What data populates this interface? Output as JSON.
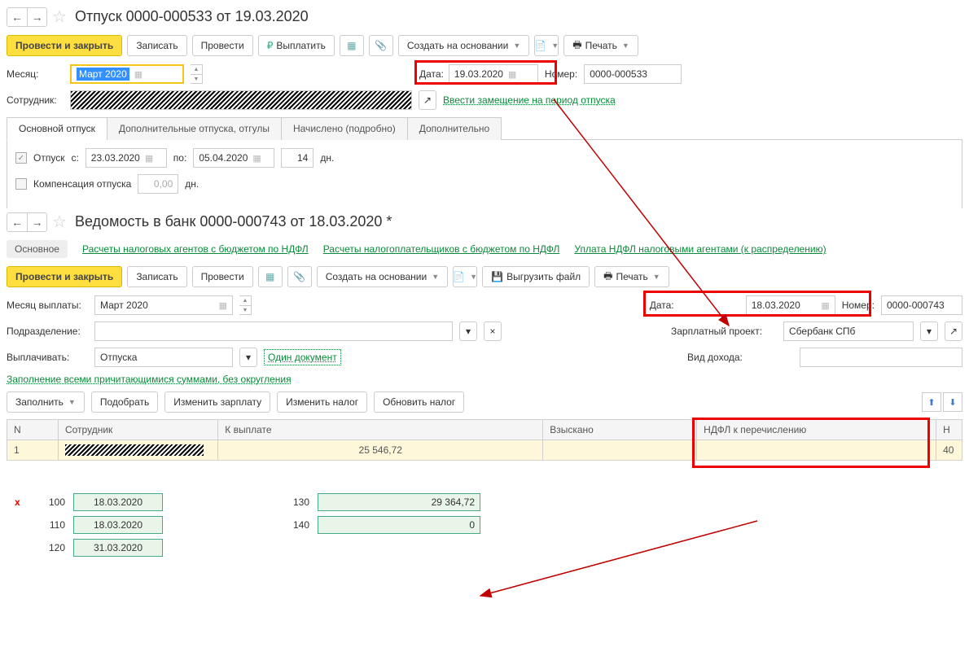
{
  "doc1": {
    "title": "Отпуск 0000-000533 от 19.03.2020",
    "toolbar": {
      "post_close": "Провести и закрыть",
      "save": "Записать",
      "post": "Провести",
      "pay": "Выплатить",
      "create_on": "Создать на основании",
      "print": "Печать"
    },
    "month_lbl": "Месяц:",
    "month": "Март 2020",
    "date_lbl": "Дата:",
    "date": "19.03.2020",
    "num_lbl": "Номер:",
    "num": "0000-000533",
    "employee_lbl": "Сотрудник:",
    "subst_link": "Ввести замещение на период отпуска",
    "tabs": [
      "Основной отпуск",
      "Дополнительные отпуска, отгулы",
      "Начислено (подробно)",
      "Дополнительно"
    ],
    "vac_lbl": "Отпуск",
    "from_lbl": "с:",
    "from": "23.03.2020",
    "to_lbl": "по:",
    "to": "05.04.2020",
    "days": "14",
    "days_lbl": "дн.",
    "comp_lbl": "Компенсация отпуска",
    "comp_val": "0,00",
    "comp_days_lbl": "дн."
  },
  "doc2": {
    "title": "Ведомость в банк 0000-000743 от 18.03.2020 *",
    "nav": {
      "main": "Основное",
      "link1": "Расчеты налоговых агентов с бюджетом по НДФЛ",
      "link2": "Расчеты налогоплательщиков с бюджетом по НДФЛ",
      "link3": "Уплата НДФЛ налоговыми агентами (к распределению)"
    },
    "toolbar": {
      "post_close": "Провести и закрыть",
      "save": "Записать",
      "post": "Провести",
      "create_on": "Создать на основании",
      "export": "Выгрузить файл",
      "print": "Печать"
    },
    "paymonth_lbl": "Месяц выплаты:",
    "paymonth": "Март 2020",
    "date_lbl": "Дата:",
    "date": "18.03.2020",
    "num_lbl": "Номер:",
    "num": "0000-000743",
    "dept_lbl": "Подразделение:",
    "proj_lbl": "Зарплатный проект:",
    "proj": "Сбербанк СПб",
    "pay_lbl": "Выплачивать:",
    "pay": "Отпуска",
    "onedoc": "Один документ",
    "income_lbl": "Вид дохода:",
    "filllink": "Заполнение всеми причитающимися суммами, без округления",
    "btns": {
      "fill": "Заполнить",
      "pick": "Подобрать",
      "chsal": "Изменить зарплату",
      "chtax": "Изменить налог",
      "updtax": "Обновить налог"
    },
    "cols": {
      "n": "N",
      "emp": "Сотрудник",
      "topay": "К выплате",
      "coll": "Взыскано",
      "ndfl": "НДФЛ к перечислению",
      "last": "Н"
    },
    "row": {
      "n": "1",
      "topay": "25 546,72",
      "last": "40"
    }
  },
  "bottom": {
    "r100": {
      "code": "100",
      "val": "18.03.2020"
    },
    "r110": {
      "code": "110",
      "val": "18.03.2020"
    },
    "r120": {
      "code": "120",
      "val": "31.03.2020"
    },
    "r130": {
      "code": "130",
      "val": "29 364,72"
    },
    "r140": {
      "code": "140",
      "val": "0"
    }
  }
}
